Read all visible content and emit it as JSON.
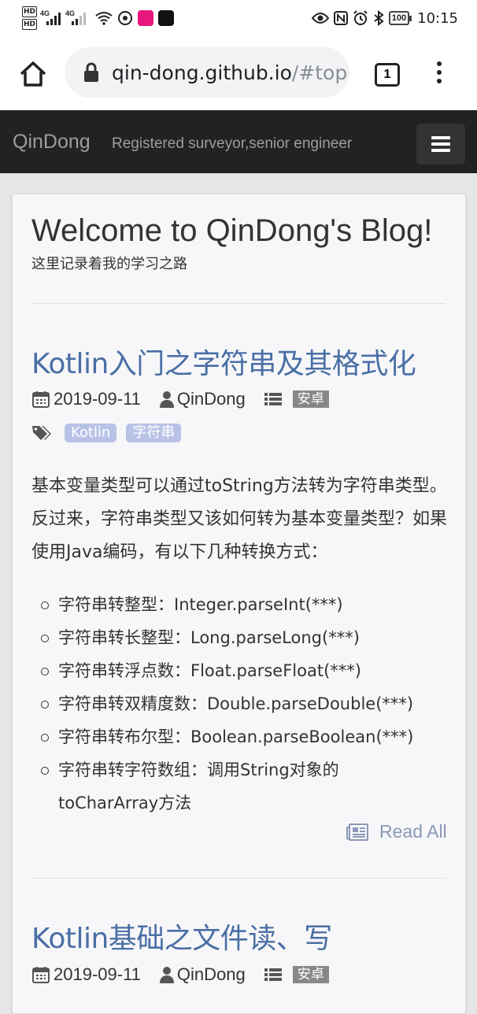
{
  "statusbar": {
    "hd_top": "HD",
    "hd_bottom": "HD",
    "net1": "4G",
    "net2": "4G",
    "battery": "100",
    "time": "10:15"
  },
  "browser": {
    "url_host": "qin-dong.github.io",
    "url_rest": "/#top",
    "tab_count": "1"
  },
  "navbar": {
    "brand": "QinDong",
    "tagline": "Registered surveyor,senior engineer"
  },
  "header": {
    "title": "Welcome to QinDong's Blog!",
    "subtitle": "这里记录着我的学习之路"
  },
  "posts": [
    {
      "title": "Kotlin入门之字符串及其格式化",
      "date": "2019-09-11",
      "author": "QinDong",
      "category": "安卓",
      "tags": [
        "Kotlin",
        "字符串"
      ],
      "excerpt": "基本变量类型可以通过toString方法转为字符串类型。反过来，字符串类型又该如何转为基本变量类型？如果使用Java编码，有以下几种转换方式：",
      "list": [
        "字符串转整型：Integer.parseInt(***)",
        "字符串转长整型：Long.parseLong(***)",
        "字符串转浮点数：Float.parseFloat(***)",
        "字符串转双精度数：Double.parseDouble(***)",
        "字符串转布尔型：Boolean.parseBoolean(***)",
        "字符串转字符数组：调用String对象的toCharArray方法"
      ],
      "read_all": "Read All"
    },
    {
      "title": "Kotlin基础之文件读、写",
      "date": "2019-09-11",
      "author": "QinDong",
      "category": "安卓"
    }
  ],
  "colors": {
    "navbar_bg": "#222222",
    "link": "#4a6fa5",
    "tag_bg": "#b8c2e6",
    "category_bg": "#888888"
  }
}
